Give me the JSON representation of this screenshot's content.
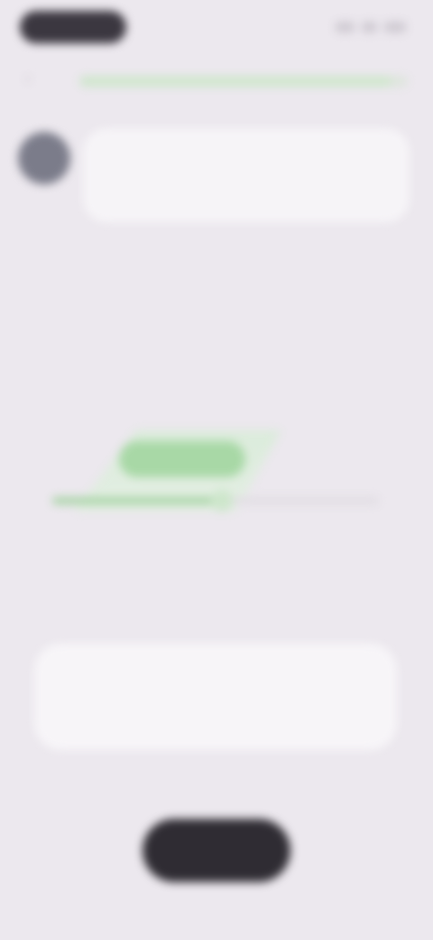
{
  "status_bar": {
    "time": "",
    "icons": [
      "signal-icon",
      "wifi-icon",
      "battery-icon"
    ]
  },
  "header": {
    "back_icon": "chevron-left-icon",
    "progress": 0.95
  },
  "question": {
    "avatar": "avatar",
    "text": ""
  },
  "value": {
    "caption": "",
    "number": "",
    "unit": ""
  },
  "slider": {
    "value_fraction": 0.52,
    "ticks": [
      "",
      "",
      "",
      ""
    ]
  },
  "info_card": {
    "line1": "",
    "line2": ""
  },
  "footer": {
    "hint": "",
    "cta_label": ""
  },
  "colors": {
    "background": "#ece8ee",
    "accent_green": "#a8d8a6",
    "cta_dark": "#2f2c33"
  }
}
